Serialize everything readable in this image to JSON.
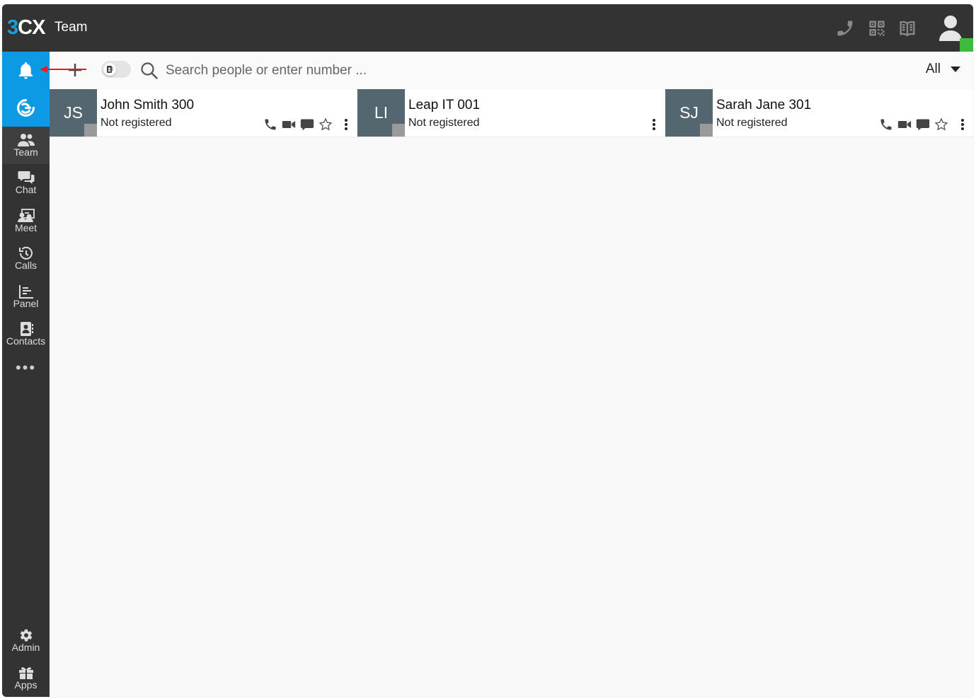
{
  "header": {
    "logo_digit": "3",
    "logo_letters": "CX",
    "title": "Team",
    "icons": [
      "phone-icon",
      "qr-code-icon",
      "book-icon",
      "user-icon"
    ],
    "presence_color": "#3dbb3d"
  },
  "sidebar": {
    "accent_color": "#0b9ae3",
    "items": [
      {
        "label": "Team",
        "icon": "team-icon"
      },
      {
        "label": "Chat",
        "icon": "chat-icon"
      },
      {
        "label": "Meet",
        "icon": "meet-icon"
      },
      {
        "label": "Calls",
        "icon": "calls-icon"
      },
      {
        "label": "Panel",
        "icon": "panel-icon"
      },
      {
        "label": "Contacts",
        "icon": "contacts-icon"
      }
    ],
    "more_label": "•••",
    "bottom_items": [
      {
        "label": "Admin",
        "icon": "gear-icon"
      },
      {
        "label": "Apps",
        "icon": "apps-icon"
      }
    ]
  },
  "toolbar": {
    "search_placeholder": "Search people or enter number ...",
    "filter_label": "All"
  },
  "contacts": [
    {
      "initials": "JS",
      "name": "John Smith 300",
      "status": "Not registered"
    },
    {
      "initials": "LI",
      "name": "Leap IT 001",
      "status": "Not registered"
    },
    {
      "initials": "SJ",
      "name": "Sarah Jane 301",
      "status": "Not registered"
    }
  ]
}
